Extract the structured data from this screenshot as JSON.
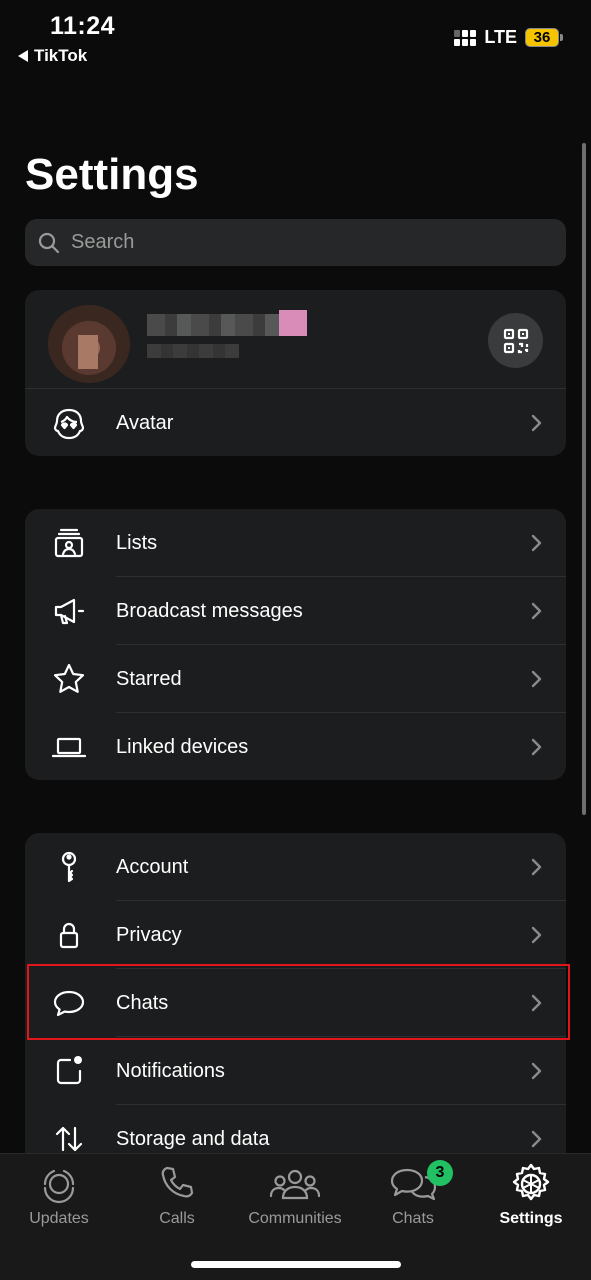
{
  "status_bar": {
    "time": "11:24",
    "back_app": "TikTok",
    "network": "LTE",
    "battery": "36"
  },
  "page_title": "Settings",
  "search": {
    "placeholder": "Search"
  },
  "profile": {
    "avatar_row_label": "Avatar"
  },
  "group1": [
    {
      "label": "Lists",
      "icon": "lists-icon"
    },
    {
      "label": "Broadcast messages",
      "icon": "megaphone-icon"
    },
    {
      "label": "Starred",
      "icon": "star-icon"
    },
    {
      "label": "Linked devices",
      "icon": "laptop-icon"
    }
  ],
  "group2": [
    {
      "label": "Account",
      "icon": "key-icon"
    },
    {
      "label": "Privacy",
      "icon": "lock-icon"
    },
    {
      "label": "Chats",
      "icon": "chat-bubble-icon"
    },
    {
      "label": "Notifications",
      "icon": "notification-icon"
    },
    {
      "label": "Storage and data",
      "icon": "storage-arrows-icon"
    }
  ],
  "tabs": [
    {
      "label": "Updates",
      "icon": "updates-icon",
      "active": false
    },
    {
      "label": "Calls",
      "icon": "phone-icon",
      "active": false
    },
    {
      "label": "Communities",
      "icon": "communities-icon",
      "active": false
    },
    {
      "label": "Chats",
      "icon": "chats-icon",
      "active": false,
      "badge": "3"
    },
    {
      "label": "Settings",
      "icon": "settings-gear-icon",
      "active": true
    }
  ],
  "colors": {
    "background": "#0b0b0b",
    "card": "#1c1d1e",
    "badge": "#21c063",
    "highlight": "#e0161b"
  }
}
